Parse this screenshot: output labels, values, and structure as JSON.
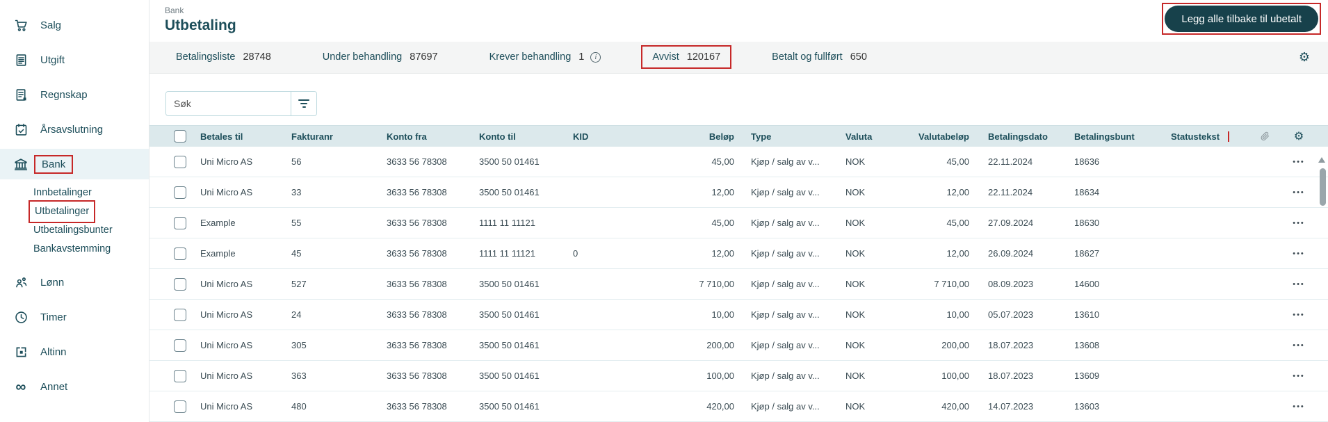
{
  "header": {
    "breadcrumb": "Bank",
    "title": "Utbetaling",
    "action_button": "Legg alle tilbake til ubetalt"
  },
  "sidebar": {
    "items": [
      {
        "label": "Salg",
        "icon": "cart-icon"
      },
      {
        "label": "Utgift",
        "icon": "invoice-icon"
      },
      {
        "label": "Regnskap",
        "icon": "ledger-icon"
      },
      {
        "label": "Årsavslutning",
        "icon": "calendar-check-icon"
      },
      {
        "label": "Bank",
        "icon": "bank-icon",
        "active": true,
        "annotated": true
      },
      {
        "label": "Lønn",
        "icon": "people-icon"
      },
      {
        "label": "Timer",
        "icon": "clock-icon"
      },
      {
        "label": "Altinn",
        "icon": "altinn-icon"
      },
      {
        "label": "Annet",
        "icon": "infinity-icon"
      }
    ],
    "bank_submenu": [
      {
        "label": "Innbetalinger"
      },
      {
        "label": "Utbetalinger",
        "annotated": true
      },
      {
        "label": "Utbetalingsbunter"
      },
      {
        "label": "Bankavstemming"
      }
    ]
  },
  "tabs": [
    {
      "label": "Betalingsliste",
      "count": "28748"
    },
    {
      "label": "Under behandling",
      "count": "87697"
    },
    {
      "label": "Krever behandling",
      "count": "1",
      "info": true
    },
    {
      "label": "Avvist",
      "count": "120167",
      "annotated": true
    },
    {
      "label": "Betalt og fullført",
      "count": "650"
    }
  ],
  "search": {
    "placeholder": "Søk"
  },
  "table": {
    "columns": [
      "Betales til",
      "Fakturanr",
      "Konto fra",
      "Konto til",
      "KID",
      "Beløp",
      "Type",
      "Valuta",
      "Valutabeløp",
      "Betalingsdato",
      "Betalingsbunt",
      "Statustekst"
    ],
    "rows": [
      {
        "betales_til": "Uni Micro AS",
        "fakturanr": "56",
        "konto_fra": "3633 56 78308",
        "konto_til": "3500 50 01461",
        "kid": "",
        "belop": "45,00",
        "type": "Kjøp / salg av v...",
        "valuta": "NOK",
        "valutabelop": "45,00",
        "betalingsdato": "22.11.2024",
        "betalingsbunt": "18636",
        "statustekst": ""
      },
      {
        "betales_til": "Uni Micro AS",
        "fakturanr": "33",
        "konto_fra": "3633 56 78308",
        "konto_til": "3500 50 01461",
        "kid": "",
        "belop": "12,00",
        "type": "Kjøp / salg av v...",
        "valuta": "NOK",
        "valutabelop": "12,00",
        "betalingsdato": "22.11.2024",
        "betalingsbunt": "18634",
        "statustekst": ""
      },
      {
        "betales_til": "Example",
        "fakturanr": "55",
        "konto_fra": "3633 56 78308",
        "konto_til": "1111 11 11121",
        "kid": "",
        "belop": "45,00",
        "type": "Kjøp / salg av v...",
        "valuta": "NOK",
        "valutabelop": "45,00",
        "betalingsdato": "27.09.2024",
        "betalingsbunt": "18630",
        "statustekst": ""
      },
      {
        "betales_til": "Example",
        "fakturanr": "45",
        "konto_fra": "3633 56 78308",
        "konto_til": "1111 11 11121",
        "kid": "0",
        "belop": "12,00",
        "type": "Kjøp / salg av v...",
        "valuta": "NOK",
        "valutabelop": "12,00",
        "betalingsdato": "26.09.2024",
        "betalingsbunt": "18627",
        "statustekst": ""
      },
      {
        "betales_til": "Uni Micro AS",
        "fakturanr": "527",
        "konto_fra": "3633 56 78308",
        "konto_til": "3500 50 01461",
        "kid": "",
        "belop": "7 710,00",
        "type": "Kjøp / salg av v...",
        "valuta": "NOK",
        "valutabelop": "7 710,00",
        "betalingsdato": "08.09.2023",
        "betalingsbunt": "14600",
        "statustekst": ""
      },
      {
        "betales_til": "Uni Micro AS",
        "fakturanr": "24",
        "konto_fra": "3633 56 78308",
        "konto_til": "3500 50 01461",
        "kid": "",
        "belop": "10,00",
        "type": "Kjøp / salg av v...",
        "valuta": "NOK",
        "valutabelop": "10,00",
        "betalingsdato": "05.07.2023",
        "betalingsbunt": "13610",
        "statustekst": ""
      },
      {
        "betales_til": "Uni Micro AS",
        "fakturanr": "305",
        "konto_fra": "3633 56 78308",
        "konto_til": "3500 50 01461",
        "kid": "",
        "belop": "200,00",
        "type": "Kjøp / salg av v...",
        "valuta": "NOK",
        "valutabelop": "200,00",
        "betalingsdato": "18.07.2023",
        "betalingsbunt": "13608",
        "statustekst": ""
      },
      {
        "betales_til": "Uni Micro AS",
        "fakturanr": "363",
        "konto_fra": "3633 56 78308",
        "konto_til": "3500 50 01461",
        "kid": "",
        "belop": "100,00",
        "type": "Kjøp / salg av v...",
        "valuta": "NOK",
        "valutabelop": "100,00",
        "betalingsdato": "18.07.2023",
        "betalingsbunt": "13609",
        "statustekst": ""
      },
      {
        "betales_til": "Uni Micro AS",
        "fakturanr": "480",
        "konto_fra": "3633 56 78308",
        "konto_til": "3500 50 01461",
        "kid": "",
        "belop": "420,00",
        "type": "Kjøp / salg av v...",
        "valuta": "NOK",
        "valutabelop": "420,00",
        "betalingsdato": "14.07.2023",
        "betalingsbunt": "13603",
        "statustekst": ""
      }
    ]
  },
  "icons": {
    "row_actions": "•••",
    "gear": "⚙",
    "info": "i"
  },
  "colors": {
    "accent": "#1d4e5a",
    "annotation": "#c62828",
    "button_bg": "#17414b",
    "button_text": "#ffffff",
    "table_header_bg": "#dce9ec",
    "tabstrip_bg": "#f4f5f5",
    "row_border": "#e3edf0",
    "active_item_bg": "#eaf3f6"
  }
}
